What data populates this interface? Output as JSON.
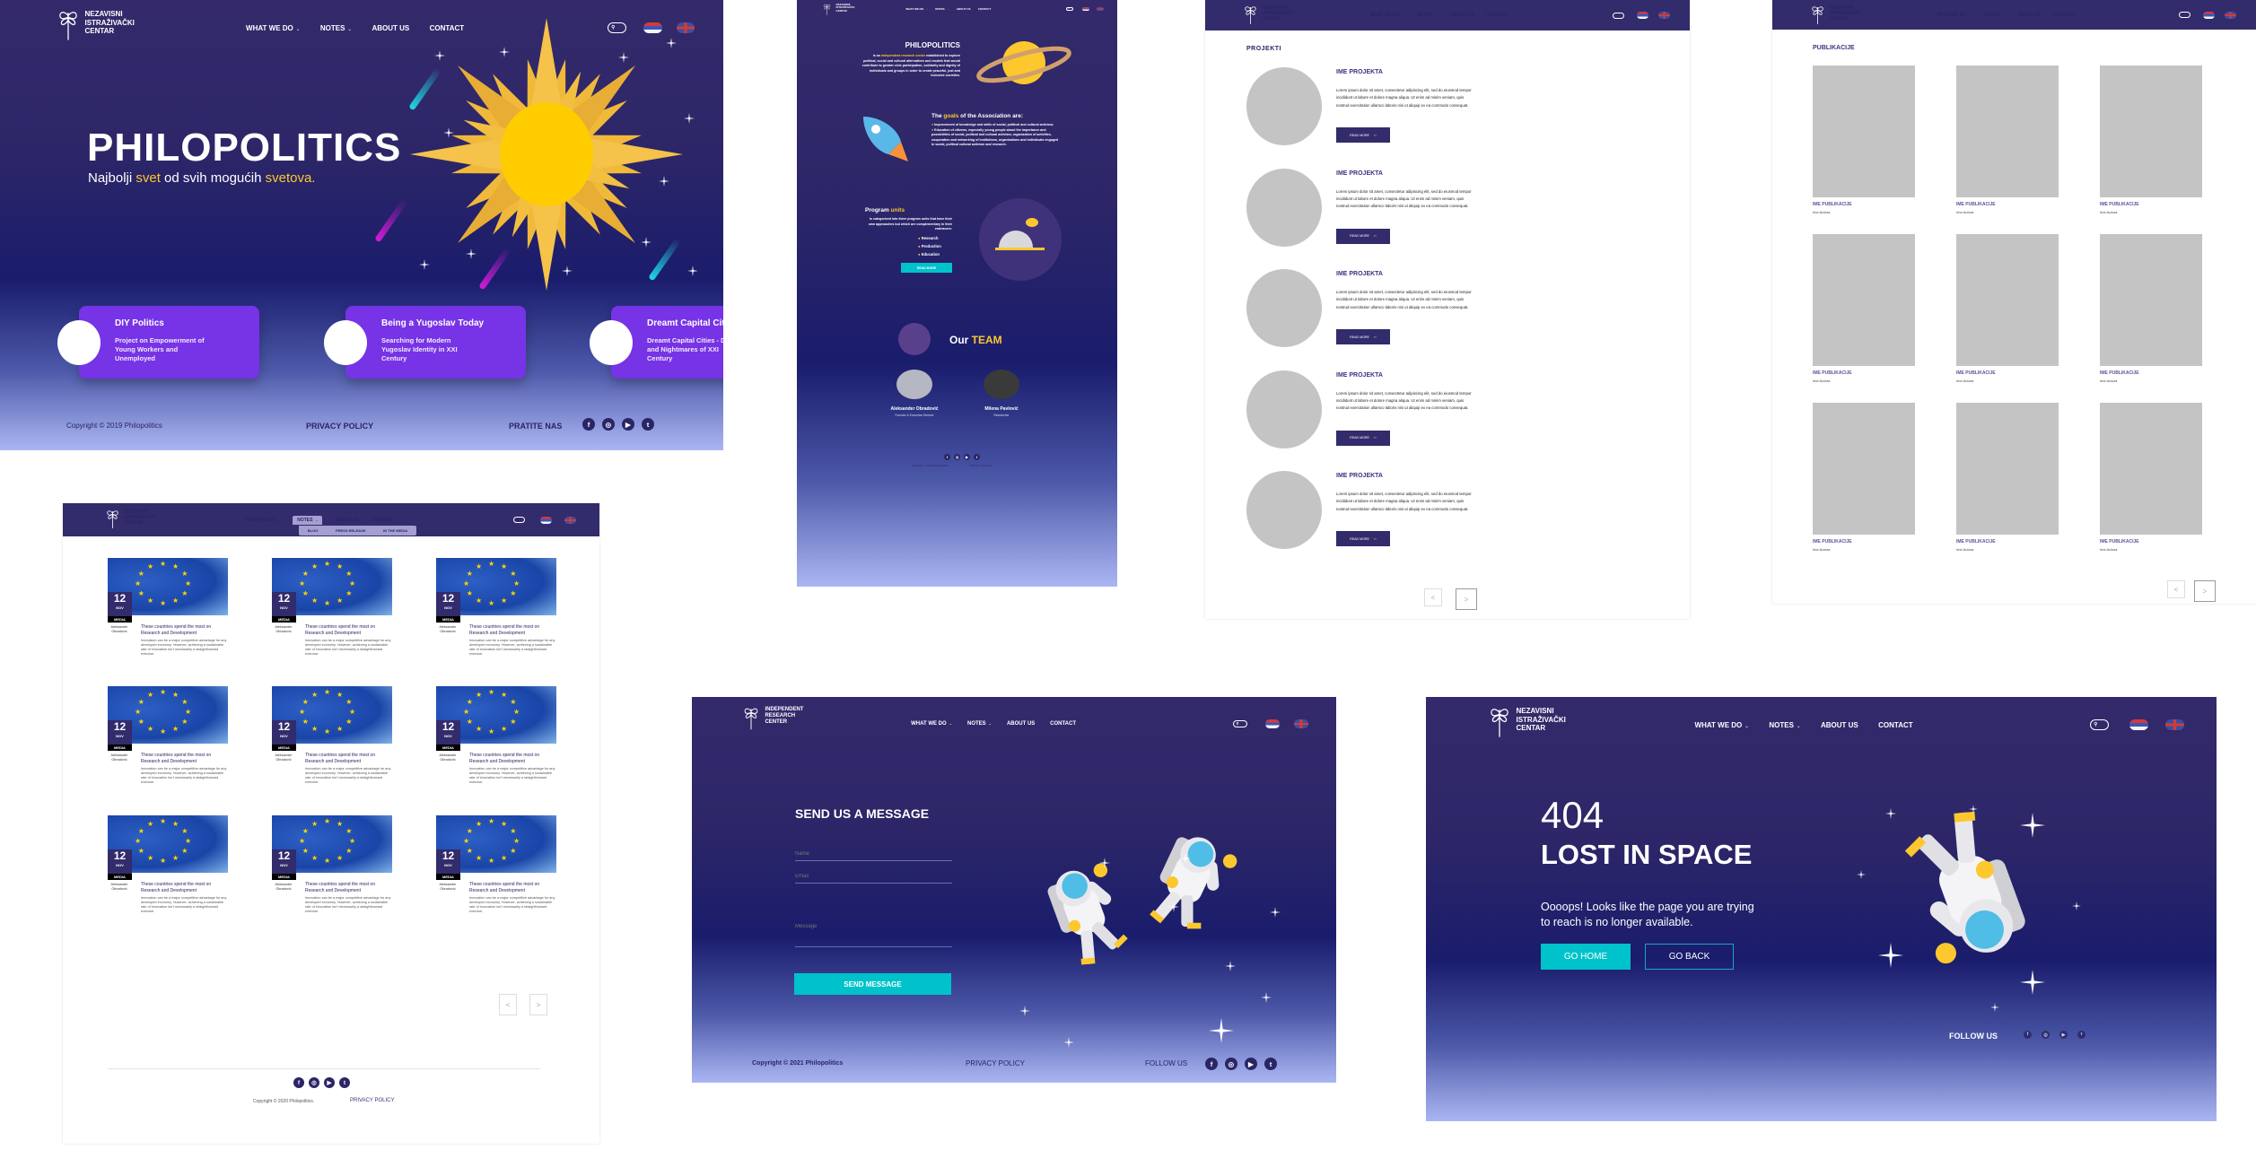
{
  "nav": {
    "logo_lines": [
      "NEZAVISNI",
      "ISTRAŽIVAČKI",
      "CENTAR"
    ],
    "items": [
      {
        "label": "WHAT WE DO",
        "dropdown": true
      },
      {
        "label": "NOTES",
        "dropdown": true
      },
      {
        "label": "ABOUT US",
        "dropdown": false
      },
      {
        "label": "CONTACT",
        "dropdown": false
      }
    ],
    "chevron": "⌄",
    "icons": [
      "search-icon",
      "serbian-flag-icon",
      "uk-flag-icon"
    ]
  },
  "nav_en": {
    "logo_lines": [
      "INDEPENDENT",
      "RESEARCH",
      "CENTER"
    ]
  },
  "notes_dropdown": [
    "BLOG",
    "PRESS RELEASE",
    "IN THE MEDIA"
  ],
  "social_icons": [
    "f",
    "◎",
    "▶",
    "t"
  ],
  "colors": {
    "primary": "#322b6c",
    "accent": "#fcc82e",
    "cyan": "#00c2cb",
    "card": "#7733e6"
  },
  "home": {
    "title": "PHILOPOLITICS",
    "subtitle": [
      "Najbolji ",
      "svet",
      " od svih mogućih ",
      "svetova."
    ],
    "cards": [
      {
        "title": "DIY Politics",
        "desc": "Project on Empowerment of Young Workers and Unemployed"
      },
      {
        "title": "Being a Yugoslav Today",
        "desc": "Searching for Modern Yugoslav Identity in XXI Century"
      },
      {
        "title": "Dreamt Capital Cities -",
        "desc": "Dreamt Capital Cities - Dreams and Nightmares of XXI Century"
      }
    ],
    "footer": {
      "copyright": "Copyright © 2019 Philopolitics",
      "privacy": "PRIVACY POLICY",
      "follow": "PRATITE NAS"
    }
  },
  "about": {
    "title": "PHILOPOLITICS",
    "intro": [
      "Is an ",
      "independent research center",
      " established to explore political, social and cultural alternatives and models that would contribute to greater civic participation, solidarity and dignity of individuals and groups in order to create peaceful, just and inclusive societies."
    ],
    "goals_heading": [
      "The ",
      "goals",
      " of the Association are:"
    ],
    "goals": [
      "Improvement of knowledge and skills of social, political and cultural activism;",
      "Education of citizens, especially young people about the importance and possibilities of social, political and cultural activism, organization of activities, cooperation and networking of institutions, organizations and individuals engaged in social, political cultural activism and research."
    ],
    "program_heading": [
      "Program ",
      "units"
    ],
    "program_text": "Is categorized into three program units that have their own approaches but which are complementary in their endeavors:",
    "units": [
      "Research",
      "Production",
      "Education"
    ],
    "read_more": "READ MORE",
    "team_heading": [
      "Our ",
      "TEAM"
    ],
    "members": [
      {
        "name": "Aleksander Obradović",
        "role": "Founder & Executive Director"
      },
      {
        "name": "Milena Pavlović",
        "role": "Researcher"
      }
    ],
    "footer": {
      "copyright": "Copyright © 2020 Philopolitics.",
      "privacy": "PRIVACY POLICY"
    }
  },
  "projects": {
    "heading": "PROJEKTI",
    "items": [
      {
        "title": "IME PROJEKTA",
        "desc": "Lorem ipsum dolor sit amet, consectetur adipiscing elit, sed do eiusmod tempor incididunt ut labore et dolore magna aliqua. Ut enim ad minim veniam, quis nostrud exercitation ullamco laboris nisi ut aliquip ex ea commodo consequat.",
        "button": "READ MORE"
      },
      {
        "title": "IME PROJEKTA",
        "desc": "Lorem ipsum dolor sit amet, consectetur adipiscing elit, sed do eiusmod tempor incididunt ut labore et dolore magna aliqua. Ut enim ad minim veniam, quis nostrud exercitation ullamco laboris nisi ut aliquip ex ea commodo consequat.",
        "button": "READ MORE"
      },
      {
        "title": "IME PROJEKTA",
        "desc": "Lorem ipsum dolor sit amet, consectetur adipiscing elit, sed do eiusmod tempor incididunt ut labore et dolore magna aliqua. Ut enim ad minim veniam, quis nostrud exercitation ullamco laboris nisi ut aliquip ex ea commodo consequat.",
        "button": "READ MORE"
      },
      {
        "title": "IME PROJEKTA",
        "desc": "Lorem ipsum dolor sit amet, consectetur adipiscing elit, sed do eiusmod tempor incididunt ut labore et dolore magna aliqua. Ut enim ad minim veniam, quis nostrud exercitation ullamco laboris nisi ut aliquip ex ea commodo consequat.",
        "button": "READ MORE"
      },
      {
        "title": "IME PROJEKTA",
        "desc": "Lorem ipsum dolor sit amet, consectetur adipiscing elit, sed do eiusmod tempor incididunt ut labore et dolore magna aliqua. Ut enim ad minim veniam, quis nostrud exercitation ullamco laboris nisi ut aliquip ex ea commodo consequat.",
        "button": "READ MORE"
      }
    ],
    "pager": [
      "<",
      ">"
    ]
  },
  "publications": {
    "heading": "PUBLIKACIJE",
    "items": [
      {
        "title": "IME PUBLIKACIJE",
        "author": "Ime Autora"
      },
      {
        "title": "IME PUBLIKACIJE",
        "author": "Ime Autora"
      },
      {
        "title": "IME PUBLIKACIJE",
        "author": "Ime Autora"
      },
      {
        "title": "IME PUBLIKACIJE",
        "author": "Ime Autora"
      },
      {
        "title": "IME PUBLIKACIJE",
        "author": "Ime Autora"
      },
      {
        "title": "IME PUBLIKACIJE",
        "author": "Ime Autora"
      },
      {
        "title": "IME PUBLIKACIJE",
        "author": "Ime Autora"
      },
      {
        "title": "IME PUBLIKACIJE",
        "author": "Ime Autora"
      },
      {
        "title": "IME PUBLIKACIJE",
        "author": "Ime Autora"
      }
    ],
    "pager": [
      "<",
      ">"
    ]
  },
  "blog": {
    "card": {
      "day": "12",
      "month": "NOV",
      "tag": "MEDIA",
      "author": "Aleksander Obradović",
      "title": "These countries spend the most on Research and Development",
      "desc": "Innovation can be a major competitive advantage for any developed economy. However, achieving a sustainable rate of innovation isn't necessarily a straightforward exercise."
    },
    "count": 9,
    "pager": [
      "<",
      ">"
    ],
    "footer": {
      "copyright": "Copyright © 2020 Philopolitics.",
      "privacy": "PRIVACY POLICY"
    }
  },
  "contact": {
    "title": "SEND US A MESSAGE",
    "name_placeholder": "Name",
    "email_placeholder": "Email",
    "message_placeholder": "Message",
    "button": "SEND MESSAGE",
    "footer": {
      "copyright": "Copyright © 2021 Philopolitics",
      "privacy": "PRIVACY POLICY",
      "follow": "FOLLOW US"
    }
  },
  "notfound": {
    "code": "404",
    "title": "LOST IN SPACE",
    "message": "Oooops! Looks like the page you are trying to reach is no longer available.",
    "go_home": "GO HOME",
    "go_back": "GO BACK",
    "follow": "FOLLOW US"
  }
}
